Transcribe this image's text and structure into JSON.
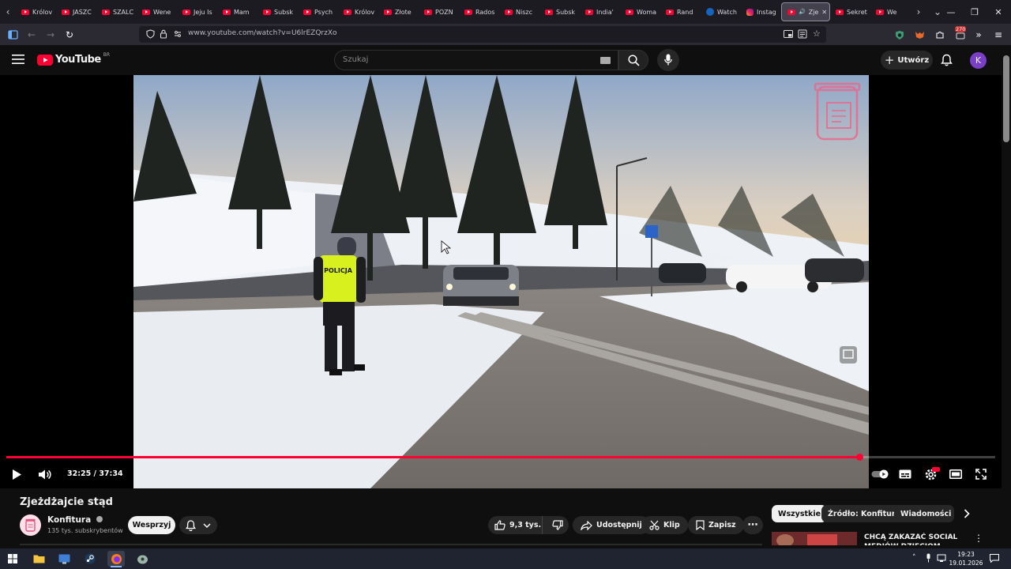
{
  "browser": {
    "tabs": [
      {
        "label": "Królov",
        "icon": "youtube-favicon"
      },
      {
        "label": "JASZC",
        "icon": "youtube-favicon"
      },
      {
        "label": "SZALC",
        "icon": "youtube-favicon"
      },
      {
        "label": "Wene",
        "icon": "youtube-favicon"
      },
      {
        "label": "Jeju Is",
        "icon": "youtube-favicon"
      },
      {
        "label": "Mam",
        "icon": "youtube-favicon"
      },
      {
        "label": "Subsk",
        "icon": "youtube-favicon"
      },
      {
        "label": "Psych",
        "icon": "youtube-favicon"
      },
      {
        "label": "Królov",
        "icon": "youtube-favicon"
      },
      {
        "label": "Złote",
        "icon": "youtube-favicon"
      },
      {
        "label": "POZN",
        "icon": "youtube-favicon"
      },
      {
        "label": "Rados",
        "icon": "youtube-favicon"
      },
      {
        "label": "Niszc",
        "icon": "youtube-favicon"
      },
      {
        "label": "Subsk",
        "icon": "youtube-favicon"
      },
      {
        "label": "India'",
        "icon": "youtube-favicon"
      },
      {
        "label": "Woma",
        "icon": "youtube-favicon"
      },
      {
        "label": "Rand",
        "icon": "youtube-favicon"
      },
      {
        "label": "Watch",
        "icon": "watch-favicon"
      },
      {
        "label": "Instag",
        "icon": "instagram-favicon"
      },
      {
        "label": "Zje",
        "icon": "youtube-favicon",
        "active": true
      },
      {
        "label": "Sekret",
        "icon": "youtube-favicon"
      },
      {
        "label": "We",
        "icon": "youtube-favicon"
      }
    ],
    "url": "www.youtube.com/watch?v=U6lrEZQrzXo",
    "extension_badge": "270"
  },
  "youtube": {
    "logo_text": "YouTube",
    "logo_region": "BR",
    "search_placeholder": "Szukaj",
    "create_label": "Utwórz",
    "avatar_letter": "K"
  },
  "player": {
    "time_current": "32:25",
    "time_total": "37:34",
    "time_display": "32:25 / 37:34",
    "progress": 0.863,
    "vest_text": "POLICJA",
    "colors": {
      "progress": "#ff0033",
      "accent": "#ff0033"
    }
  },
  "video": {
    "title": "Zjeżdżajcie stąd",
    "channel": "Konfitura",
    "subscribers": "135 tys. subskrybentów",
    "support_label": "Wesprzyj",
    "likes": "9,3 tys.",
    "share_label": "Udostępnij",
    "clip_label": "Klip",
    "save_label": "Zapisz"
  },
  "sidebar": {
    "chips": [
      "Wszystkie",
      "Źródło: Konfitura",
      "Wiadomości ze"
    ],
    "next_video_title": "CHCĄ ZAKAZAĆ SOCIAL MEDIÓW DZIECIOM"
  },
  "taskbar": {
    "time": "19:23",
    "date": "19.01.2026"
  }
}
